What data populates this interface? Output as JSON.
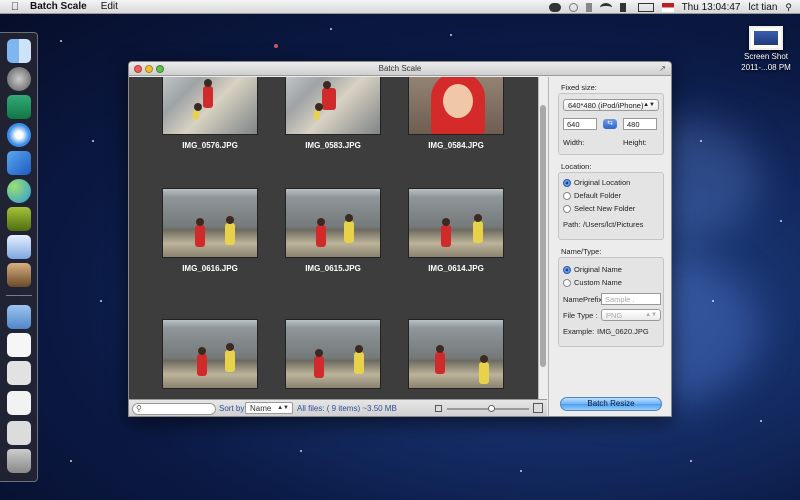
{
  "menubar": {
    "apple_icon": "apple-logo",
    "app_name": "Batch Scale",
    "menus": [
      "Edit"
    ],
    "clock": "Thu 13:04:47",
    "user": "lct tian"
  },
  "desktop": {
    "icon_label_line1": "Screen Shot",
    "icon_label_line2": "2011-...08 PM"
  },
  "window": {
    "title": "Batch Scale",
    "photos": [
      {
        "name": "IMG_0576.JPG",
        "scene": "plaza"
      },
      {
        "name": "IMG_0583.JPG",
        "scene": "plaza"
      },
      {
        "name": "IMG_0584.JPG",
        "scene": "face"
      },
      {
        "name": "IMG_0616.JPG",
        "scene": "wall"
      },
      {
        "name": "IMG_0615.JPG",
        "scene": "wall"
      },
      {
        "name": "IMG_0614.JPG",
        "scene": "wall"
      },
      {
        "name": "",
        "scene": "wall"
      },
      {
        "name": "",
        "scene": "wall"
      },
      {
        "name": "",
        "scene": "wall"
      }
    ],
    "bottom": {
      "search_placeholder": "",
      "sort_label": "Sort by:",
      "sort_value": "Name",
      "status": "All files: ( 9 items) ~3.50 MB",
      "zoom_level": 0.55
    }
  },
  "panel": {
    "fixed_size": {
      "title": "Fixed size:",
      "preset": "640*480 (iPod/iPhone)",
      "width": "640",
      "height": "480",
      "width_label": "Width:",
      "height_label": "Height:"
    },
    "location": {
      "title": "Location:",
      "options": [
        "Original Location",
        "Default Folder",
        "Select New Folder"
      ],
      "selected": 0,
      "path_label": "Path:",
      "path_value": "/Users/lct/Pictures"
    },
    "name_type": {
      "title": "Name/Type:",
      "options": [
        "Original Name",
        "Custom Name"
      ],
      "selected": 0,
      "prefix_label": "NamePrefix:",
      "prefix_placeholder": "Sample .",
      "filetype_label": "File Type :",
      "filetype_value": "PNG",
      "example_label": "Example:",
      "example_value": "IMG_0620.JPG"
    },
    "action_button": "Batch Resize"
  }
}
